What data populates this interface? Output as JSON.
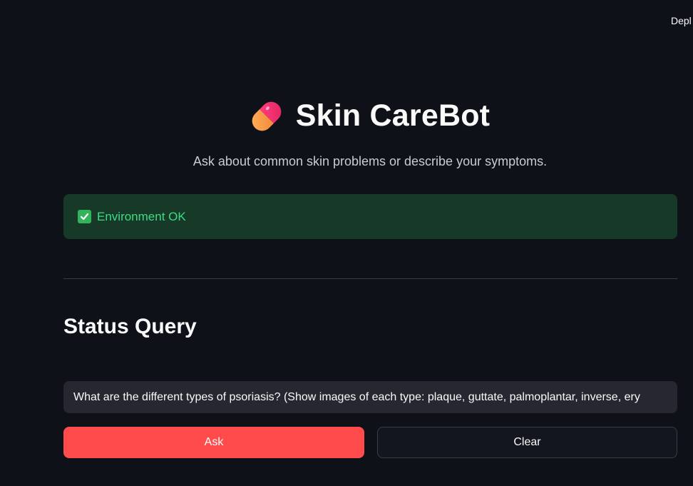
{
  "header": {
    "deploy_label": "Depl"
  },
  "app": {
    "icon": "pill-icon",
    "title": "Skin CareBot",
    "subtitle": "Ask about common skin problems or describe your symptoms."
  },
  "status": {
    "icon": "check-icon",
    "text": "Environment OK"
  },
  "query_section": {
    "heading": "Status Query",
    "input_value": "What are the different types of psoriasis? (Show images of each type: plaque, guttate, palmoplantar, inverse, ery",
    "ask_label": "Ask",
    "clear_label": "Clear"
  },
  "colors": {
    "background": "#0e1117",
    "accent": "#ff4b4b",
    "success_bg": "#173928",
    "success_text": "#3ddc84"
  }
}
